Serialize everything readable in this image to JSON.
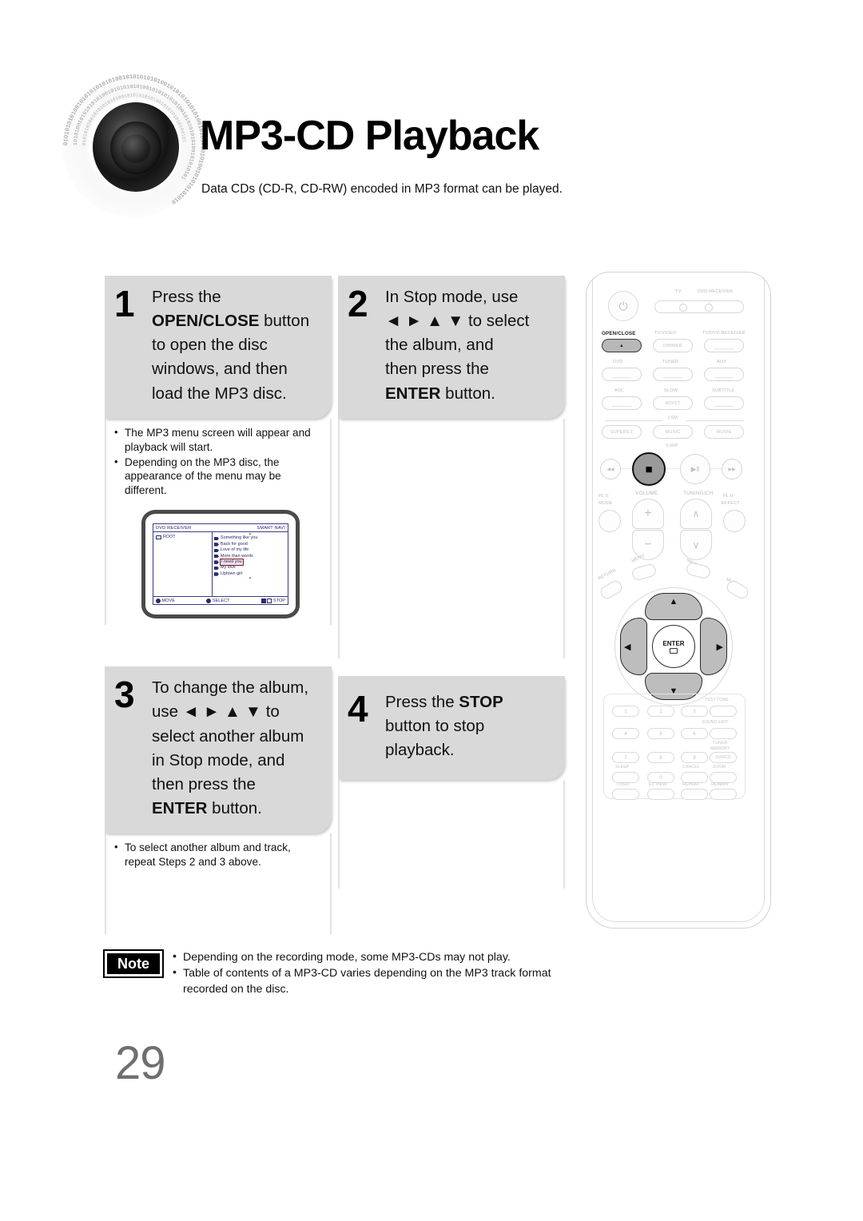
{
  "header": {
    "title": "MP3-CD Playback",
    "subtitle": "Data CDs (CD-R, CD-RW) encoded in MP3 format can be played.",
    "disc_icon": "speaker-disc-binary-icon"
  },
  "steps": [
    {
      "number": "1",
      "lines": [
        {
          "text": "Press the",
          "bold": false
        },
        {
          "text": "OPEN/CLOSE",
          "bold": true,
          "suffix": " button"
        },
        {
          "text": "to open the disc",
          "bold": false
        },
        {
          "text": "windows, and then",
          "bold": false
        },
        {
          "text": "load the MP3 disc.",
          "bold": false
        }
      ],
      "bullets": [
        "The MP3 menu screen will appear and playback will start.",
        "Depending on the MP3 disc, the appearance of the menu may be different."
      ]
    },
    {
      "number": "2",
      "lines": [
        {
          "text": "In Stop mode, use",
          "bold": false
        },
        {
          "text": "◄ ► ▲ ▼ to select",
          "bold": false
        },
        {
          "text": "the album, and",
          "bold": false
        },
        {
          "text": "then press the",
          "bold": false
        },
        {
          "text": "ENTER",
          "bold": true,
          "suffix": " button."
        }
      ],
      "bullets": []
    },
    {
      "number": "3",
      "lines": [
        {
          "text": "To change the album,",
          "bold": false
        },
        {
          "text": "use ◄ ► ▲ ▼  to",
          "bold": false
        },
        {
          "text": "select another album",
          "bold": false
        },
        {
          "text": "in Stop mode, and",
          "bold": false
        },
        {
          "text": "then press the",
          "bold": false
        },
        {
          "text": "ENTER",
          "bold": true,
          "suffix": " button."
        }
      ],
      "bullets": [
        "To select another album and track, repeat Steps 2 and 3 above."
      ]
    },
    {
      "number": "4",
      "lines": [
        {
          "text": "Press the ",
          "bold": false,
          "bold_tail": "STOP"
        },
        {
          "text": "button to stop",
          "bold": false
        },
        {
          "text": "playback.",
          "bold": false
        }
      ],
      "bullets": []
    }
  ],
  "tv_screen": {
    "header_left": "DVD RECEIVER",
    "header_right": "SMART NAVI",
    "root_label": "ROOT",
    "tracks": [
      {
        "name": "Something like you",
        "selected": false
      },
      {
        "name": "Back for good",
        "selected": false
      },
      {
        "name": "Love of my life",
        "selected": false
      },
      {
        "name": "More than words",
        "selected": false
      },
      {
        "name": "I need you",
        "selected": true
      },
      {
        "name": "My love",
        "selected": false
      },
      {
        "name": "Uptown girl",
        "selected": false
      }
    ],
    "footer": [
      {
        "label": "MOVE",
        "icon": "dpad-badge"
      },
      {
        "label": "SELECT",
        "icon": "enter-badge"
      },
      {
        "label": "STOP",
        "icon": "stop-badge"
      }
    ]
  },
  "note": {
    "badge": "Note",
    "items": [
      "Depending on the recording mode, some MP3-CDs may not play.",
      "Table of contents of a MP3-CD varies depending on the MP3 track format recorded on the disc."
    ]
  },
  "page_number": "29",
  "remote": {
    "power_glyph": "⏻",
    "mode_labels": {
      "tv": "TV",
      "dvd_receiver": "DVD RECEIVER"
    },
    "row_open": {
      "open_close": "OPEN/CLOSE",
      "open_close_glyph": "▲",
      "tv_video": "TV/VIDEO",
      "dimmer": "DIMMER",
      "tv_dvd_receiver": "TV/DVD RECEIVER"
    },
    "row_source": {
      "dvd": "DVD",
      "tuner": "TUNER",
      "aux": "AUX"
    },
    "row_asc": {
      "asc": "ASC",
      "slow": "SLOW",
      "most": "MO/ST",
      "subtitle": "SUBTITLE"
    },
    "lsm_label": "LSM",
    "row_lsm": {
      "super": "SUPER5.1",
      "music": "MUSIC",
      "movie": "MOVIE"
    },
    "vhip_label": "V-HIP",
    "transport": {
      "prev": "◀◀",
      "stop": "■",
      "play_pause": "▶‖",
      "next": "▶▶"
    },
    "volume_label": "VOLUME",
    "tuning_label": "TUNING/CH",
    "plii_mode": {
      "top": "PL II",
      "bottom": "MODE"
    },
    "plii_effect": {
      "top": "PL II",
      "bottom": "EFFECT"
    },
    "around_nav": {
      "return": "RETURN",
      "menu": "MENU",
      "info": "INFO",
      "mute": "MUTE"
    },
    "nav": {
      "up": "▲",
      "down": "▼",
      "left": "◀",
      "right": "▶",
      "enter": "ENTER"
    },
    "keypad": {
      "digits": [
        "1",
        "2",
        "3",
        "4",
        "5",
        "6",
        "7",
        "8",
        "9",
        "0"
      ],
      "test_tone": "TEST TONE",
      "sound_edit": "SOUND EDIT",
      "tuner_memory": "TUNER\nMEMORY",
      "dvd_cd": "DVD/CD",
      "sleep": "SLEEP",
      "cancel": "CANCEL",
      "zoom": "ZOOM",
      "logo": "LOGO",
      "ez_view": "EZ VIEW",
      "repeat": "REPEAT",
      "remain": "REMAIN"
    }
  },
  "colors": {
    "step_box_bg": "#d9d9d9",
    "page_number": "#6f6f6f",
    "osd_blue": "#2a2a6e",
    "highlight_red": "#7a1f2a",
    "remote_highlight": "#b8b8b8"
  }
}
